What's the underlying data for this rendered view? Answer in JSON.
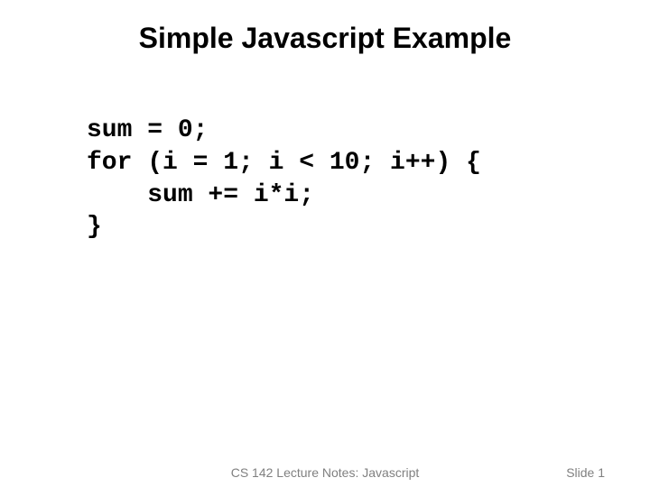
{
  "title": "Simple Javascript Example",
  "code": "sum = 0;\nfor (i = 1; i < 10; i++) {\n    sum += i*i;\n}",
  "footer": {
    "lecture": "CS 142 Lecture Notes: Javascript",
    "slide": "Slide 1"
  }
}
